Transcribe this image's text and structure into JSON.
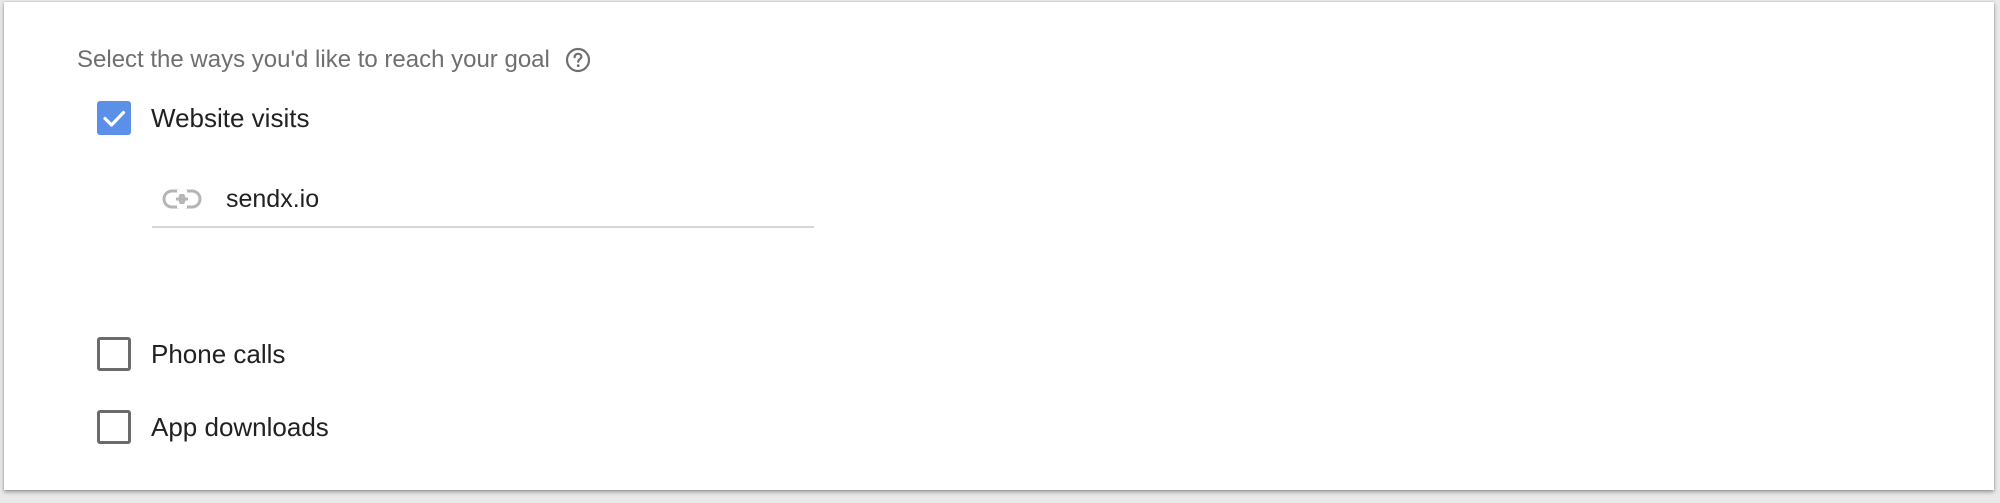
{
  "section": {
    "heading": "Select the ways you'd like to reach your goal",
    "help_icon": "help-circle-icon"
  },
  "options": [
    {
      "label": "Website visits",
      "checked": true
    },
    {
      "label": "Phone calls",
      "checked": false
    },
    {
      "label": "App downloads",
      "checked": false
    }
  ],
  "website_field": {
    "value": "sendx.io",
    "icon": "link-icon"
  },
  "colors": {
    "checkbox_checked": "#5b8fe8",
    "checkbox_border": "#6b6b6b",
    "heading_text": "#6f6f6f",
    "body_text": "#212121"
  }
}
